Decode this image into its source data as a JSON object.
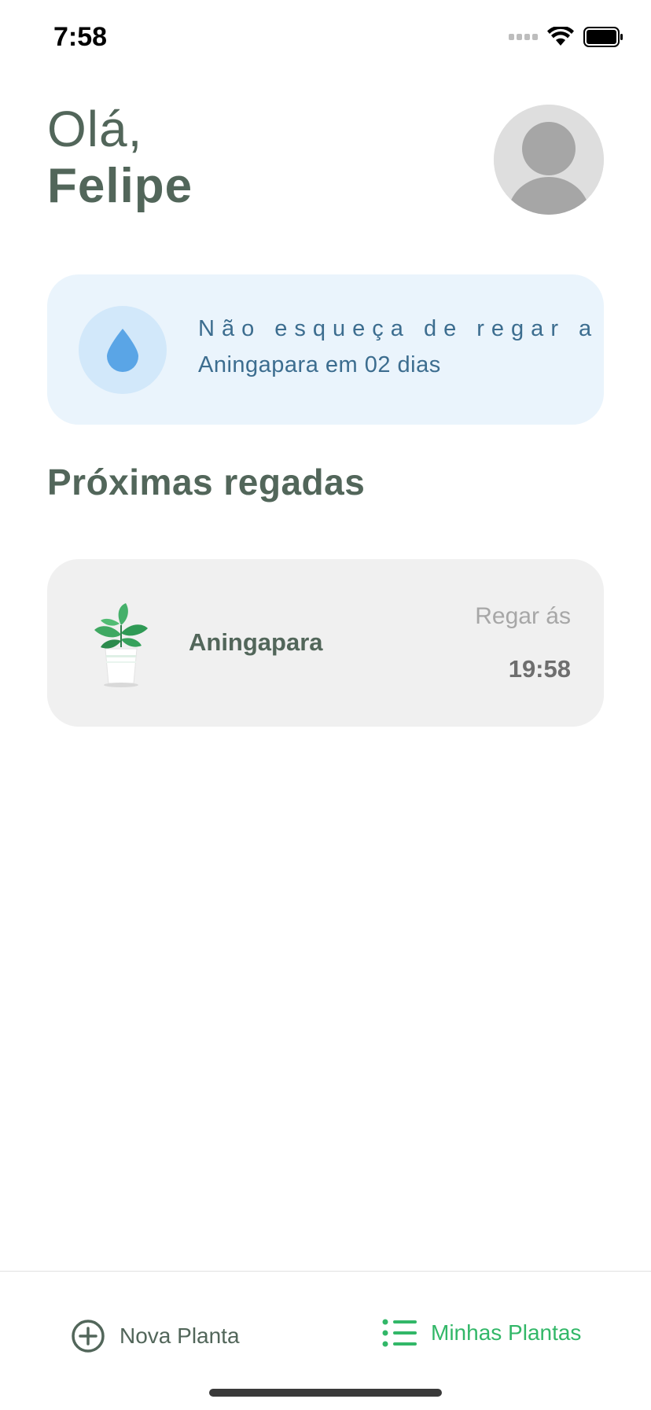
{
  "status_bar": {
    "time": "7:58",
    "icons": [
      "signal-icon",
      "wifi-icon",
      "battery-icon"
    ]
  },
  "header": {
    "greeting": "Olá,",
    "user_name": "Felipe",
    "avatar_icon": "user-avatar-icon"
  },
  "reminder": {
    "icon": "water-drop-icon",
    "line1": "Não esqueça de regar a",
    "line2": "Aningapara em 02 dias"
  },
  "section": {
    "title": "Próximas regadas"
  },
  "plants": [
    {
      "name": "Aningapara",
      "water_label": "Regar ás",
      "water_time": "19:58",
      "image_icon": "potted-plant-icon"
    }
  ],
  "tab_bar": {
    "new_plant": {
      "label": "Nova Planta",
      "icon": "plus-circle-icon"
    },
    "my_plants": {
      "label": "Minhas Plantas",
      "icon": "list-icon",
      "active": true
    }
  },
  "colors": {
    "heading": "#52665A",
    "accent": "#32B768",
    "reminder_bg": "#EAF4FC",
    "reminder_text": "#3C6D8F",
    "card_bg": "#F0F0F0"
  }
}
